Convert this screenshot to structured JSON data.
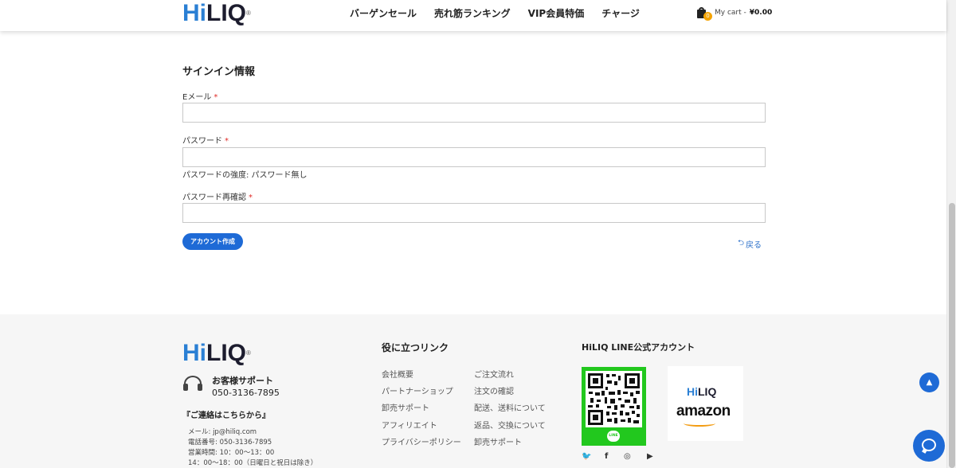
{
  "header": {
    "logo": {
      "hi": "Hi",
      "liq": "LIQ",
      "mark": "®"
    },
    "nav": [
      "バーゲンセール",
      "売れ筋ランキング",
      "VIP会員特価",
      "チャージ"
    ],
    "cart": {
      "badge": "0",
      "label": "My cart -",
      "amount": "¥0.00",
      "icon": "shopping-bag-icon"
    }
  },
  "form": {
    "section_title": "サインイン情報",
    "email_label": "Eメール",
    "password_label": "パスワード",
    "strength_text": "パスワードの強度: パスワード無し",
    "confirm_label": "パスワード再確認",
    "required_mark": "*",
    "create_button": "アカウント作成",
    "back_link": "戻る"
  },
  "footer": {
    "logo": {
      "hi": "Hi",
      "liq": "LIQ",
      "mark": "®"
    },
    "support_title": "お客様サポート",
    "support_phone": "050-3136-7895",
    "contact_heading": "『ご連絡はこちらから』",
    "contact_lines": [
      "メール: jp@hiliq.com",
      "電話番号: 050-3136-7895",
      "営業時間: 10：00〜13：00",
      "14：00〜18：00（日曜日と祝日は除き）"
    ],
    "links_title": "役に立つリンク",
    "links_col1": [
      "会社概要",
      "パートナーショップ",
      "卸売サポート",
      "アフィリエイト",
      "プライバシーポリシー"
    ],
    "links_col2": [
      "ご注文流れ",
      "注文の確認",
      "配送、送料について",
      "返品、交換について",
      "卸売サポート"
    ],
    "line_title": "HiLIQ LINE公式アカウント",
    "line_badge": "LINE",
    "amazon": {
      "hi": "Hi",
      "liq": "LIQ",
      "word": "amazon"
    },
    "social_icons": [
      "twitter-icon",
      "facebook-icon",
      "instagram-icon",
      "youtube-icon"
    ]
  },
  "colors": {
    "accent": "#1e6ad6",
    "logo_blue": "#2a7fd4",
    "required": "#e02b27",
    "line_green": "#22c81e"
  }
}
